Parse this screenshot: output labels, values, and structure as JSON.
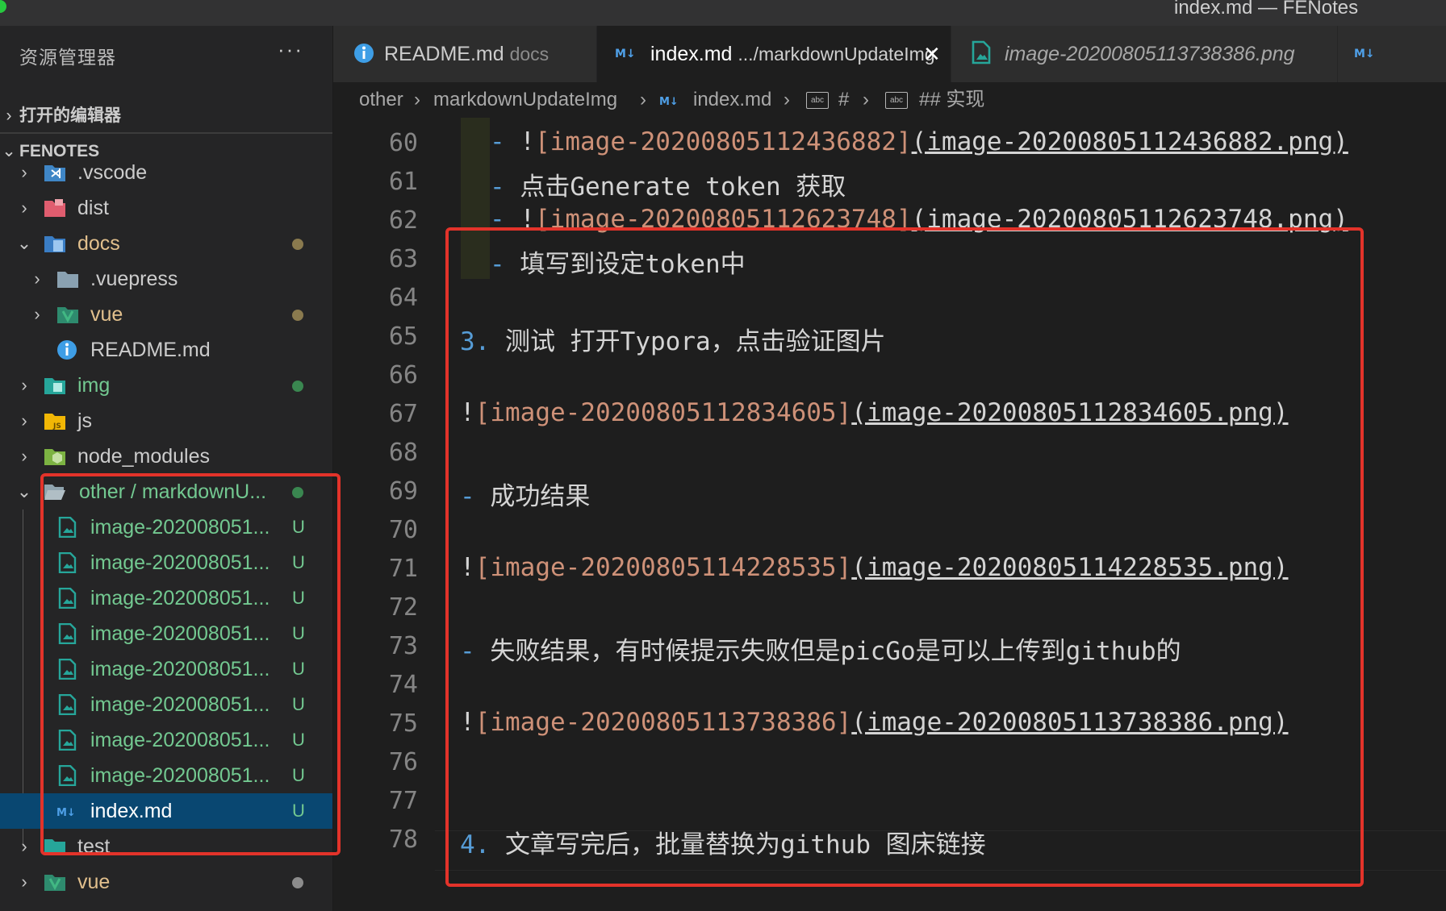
{
  "window": {
    "title": "index.md — FENotes"
  },
  "sidebar": {
    "header": "资源管理器",
    "more": "···",
    "open_editors": "打开的编辑器",
    "project": "FENOTES",
    "items": [
      {
        "name": ".vscode"
      },
      {
        "name": "dist"
      },
      {
        "name": "docs"
      },
      {
        "name": ".vuepress"
      },
      {
        "name": "vue"
      },
      {
        "name": "README.md"
      },
      {
        "name": "img"
      },
      {
        "name": "js"
      },
      {
        "name": "node_modules"
      },
      {
        "name": "other / markdownU..."
      },
      {
        "name": "image-202008051...",
        "badge": "U"
      },
      {
        "name": "image-202008051...",
        "badge": "U"
      },
      {
        "name": "image-202008051...",
        "badge": "U"
      },
      {
        "name": "image-202008051...",
        "badge": "U"
      },
      {
        "name": "image-202008051...",
        "badge": "U"
      },
      {
        "name": "image-202008051...",
        "badge": "U"
      },
      {
        "name": "image-202008051...",
        "badge": "U"
      },
      {
        "name": "image-202008051...",
        "badge": "U"
      },
      {
        "name": "index.md",
        "badge": "U"
      },
      {
        "name": "test"
      },
      {
        "name": "vue"
      }
    ]
  },
  "tabs": [
    {
      "label": "README.md",
      "desc": "docs"
    },
    {
      "label": "index.md",
      "desc": ".../markdownUpdateImg",
      "close": "✕"
    },
    {
      "label": "image-20200805113738386.png"
    }
  ],
  "breadcrumb": [
    "other",
    "markdownUpdateImg",
    "index.md",
    "#",
    "## 实现"
  ],
  "breadcrumb_icons": [
    "abc",
    "abc"
  ],
  "editor": {
    "lines": [
      {
        "n": "60",
        "dash": "- ",
        "bang": "!",
        "alt": "[image-20200805112436882]",
        "url": "(image-20200805112436882.png)"
      },
      {
        "n": "61",
        "dash": "- ",
        "text": "点击Generate token 获取"
      },
      {
        "n": "62",
        "dash": "- ",
        "bang": "!",
        "alt": "[image-20200805112623748]",
        "url": "(image-20200805112623748.png)"
      },
      {
        "n": "63",
        "dash": "- ",
        "text": "填写到设定token中"
      },
      {
        "n": "64"
      },
      {
        "n": "65",
        "num": "3. ",
        "text": "测试 打开Typora，点击验证图片"
      },
      {
        "n": "66"
      },
      {
        "n": "67",
        "bang": "!",
        "alt": "[image-20200805112834605]",
        "url": "(image-20200805112834605.png)"
      },
      {
        "n": "68"
      },
      {
        "n": "69",
        "dash": "- ",
        "text": "成功结果"
      },
      {
        "n": "70"
      },
      {
        "n": "71",
        "bang": "!",
        "alt": "[image-20200805114228535]",
        "url": "(image-20200805114228535.png)"
      },
      {
        "n": "72"
      },
      {
        "n": "73",
        "dash": "- ",
        "text": "失败结果，有时候提示失败但是picGo是可以上传到github的"
      },
      {
        "n": "74"
      },
      {
        "n": "75",
        "bang": "!",
        "alt": "[image-20200805113738386]",
        "url": "(image-20200805113738386.png)"
      },
      {
        "n": "76"
      },
      {
        "n": "77"
      },
      {
        "n": "78",
        "num": "4. ",
        "text": "文章写完后，批量替换为github 图床链接"
      }
    ]
  },
  "colors": {
    "annotation": "#e3332a",
    "untracked": "#73c991",
    "selection": "#094771",
    "accent": "#569cd6"
  }
}
